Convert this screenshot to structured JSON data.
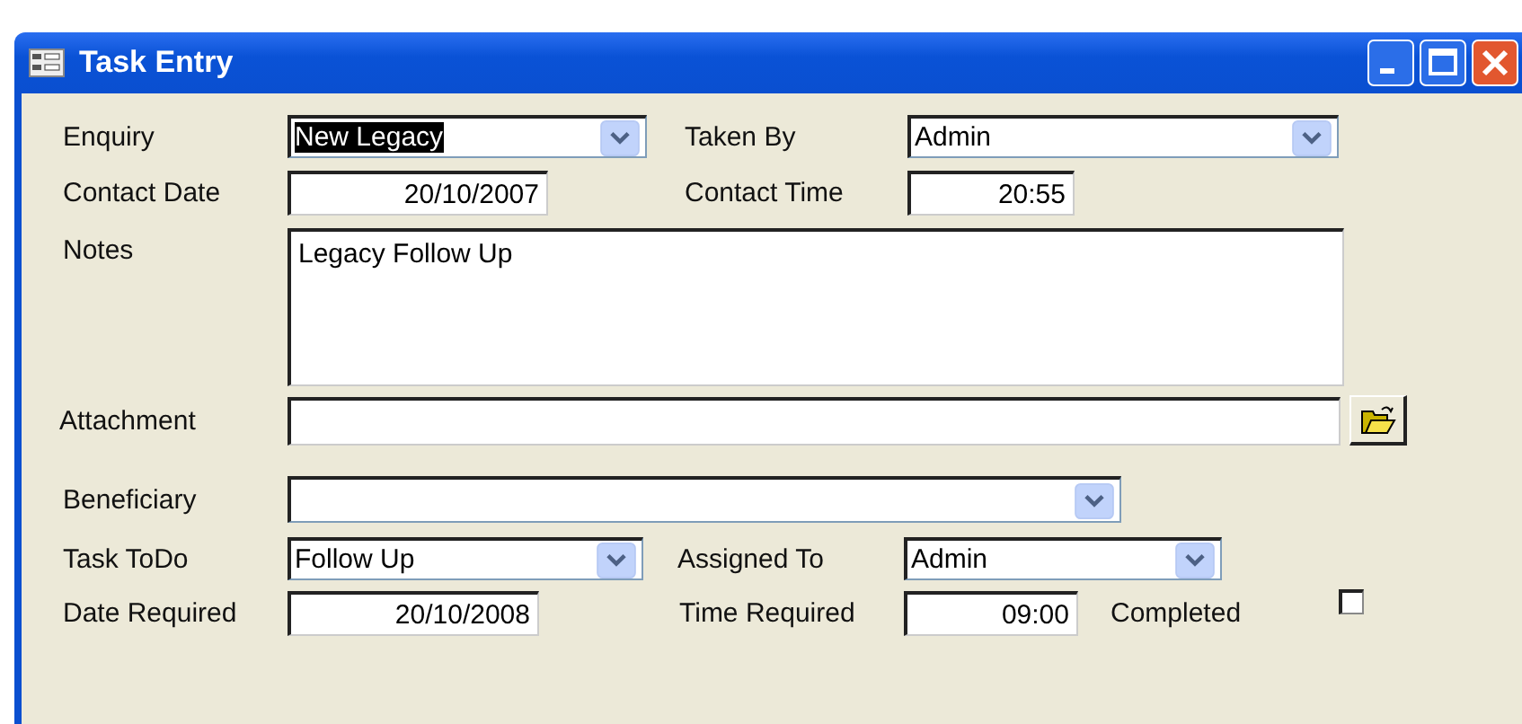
{
  "window": {
    "title": "Task Entry"
  },
  "enquiry": {
    "label": "Enquiry",
    "value": "New Legacy",
    "selected": true
  },
  "taken_by": {
    "label": "Taken By",
    "value": "Admin"
  },
  "contact_date": {
    "label": "Contact Date",
    "value": "20/10/2007"
  },
  "contact_time": {
    "label": "Contact Time",
    "value": "20:55"
  },
  "notes": {
    "label": "Notes",
    "value": "Legacy Follow Up"
  },
  "attachment": {
    "label": "Attachment"
  },
  "beneficiary": {
    "label": "Beneficiary"
  },
  "task_todo": {
    "label": "Task ToDo",
    "value": "Follow Up"
  },
  "assigned_to": {
    "label": "Assigned To",
    "value": "Admin"
  },
  "date_required": {
    "label": "Date Required",
    "value": "20/10/2008"
  },
  "time_required": {
    "label": "Time Required",
    "value": "09:00"
  },
  "completed": {
    "label": "Completed",
    "checked": false
  }
}
